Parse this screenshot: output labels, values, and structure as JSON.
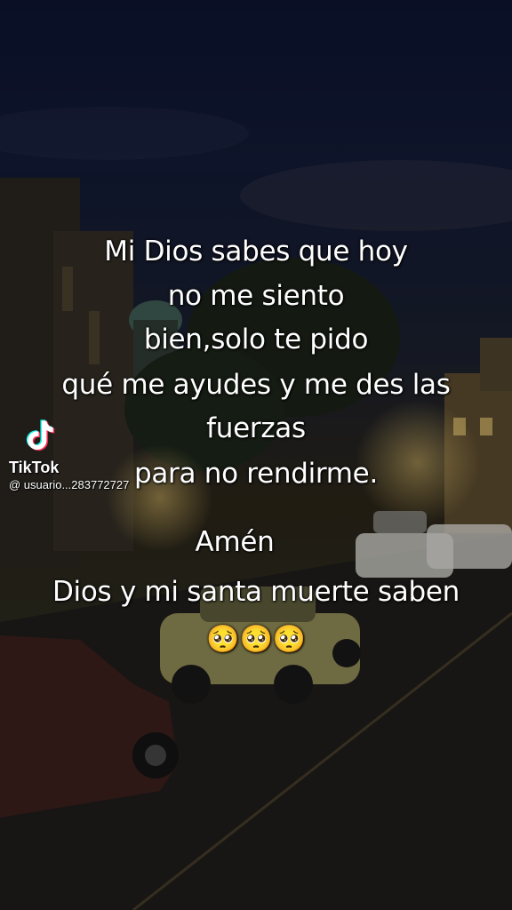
{
  "caption": {
    "lines": [
      "Mi Dios sabes que hoy",
      "no me siento",
      "bien,solo te pido",
      "qué me ayudes y me des las",
      "fuerzas",
      "para no rendirme.",
      "Amén",
      "Dios y mi santa muerte saben",
      "🥺🥺🥺"
    ]
  },
  "watermark": {
    "brand": "TikTok",
    "username": "@ usuario...283772727",
    "icon": "tiktok-logo-icon"
  }
}
